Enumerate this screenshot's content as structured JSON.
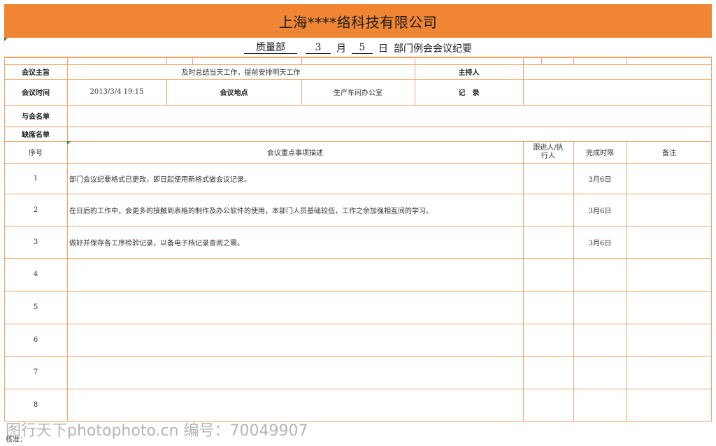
{
  "header": {
    "company": "上海****络科技有限公司"
  },
  "subtitle": {
    "dept": "质量部",
    "month": "3",
    "month_label": "月",
    "day": "5",
    "day_label": "日",
    "title": "部门例会会议纪要"
  },
  "info": {
    "purpose_label": "会议主旨",
    "purpose_value": "及时总结当天工作，提前安排明天工作",
    "host_label": "主持人",
    "host_value": "",
    "time_label": "会议时间",
    "time_value": "2013/3/4 19:15",
    "place_label": "会议地点",
    "place_value": "生产车间办公室",
    "record_label": "记　录",
    "record_value": "",
    "attend_label": "与会名单",
    "absent_label": "缺席名单"
  },
  "table": {
    "headers": {
      "no": "序号",
      "desc": "会议重点事项描述",
      "owner": "跟进人/执行人",
      "deadline": "完成时限",
      "note": "备注"
    },
    "rows": [
      {
        "no": "1",
        "desc": "部门会议纪要格式已更改，即日起使用新格式做会议记录。",
        "owner": "",
        "deadline": "3月6日",
        "note": ""
      },
      {
        "no": "2",
        "desc": "在日后的工作中，会更多的接触到表格的制作及办公软件的使用，本部门人员基础较低，工作之余加强相互间的学习。",
        "owner": "",
        "deadline": "3月6日",
        "note": ""
      },
      {
        "no": "3",
        "desc": "做好并保存各工序检验记录，以备电子档记录查阅之需。",
        "owner": "",
        "deadline": "3月6日",
        "note": ""
      },
      {
        "no": "4",
        "desc": "",
        "owner": "",
        "deadline": "",
        "note": ""
      },
      {
        "no": "5",
        "desc": "",
        "owner": "",
        "deadline": "",
        "note": ""
      },
      {
        "no": "6",
        "desc": "",
        "owner": "",
        "deadline": "",
        "note": ""
      },
      {
        "no": "7",
        "desc": "",
        "owner": "",
        "deadline": "",
        "note": ""
      },
      {
        "no": "8",
        "desc": "",
        "owner": "",
        "deadline": "",
        "note": ""
      }
    ]
  },
  "watermark": "图行天下photophoto.cn  编号：70049907",
  "footer": {
    "review_label": "核准："
  },
  "colors": {
    "header_bg": "#f08534",
    "grid": "#f0a46a"
  }
}
